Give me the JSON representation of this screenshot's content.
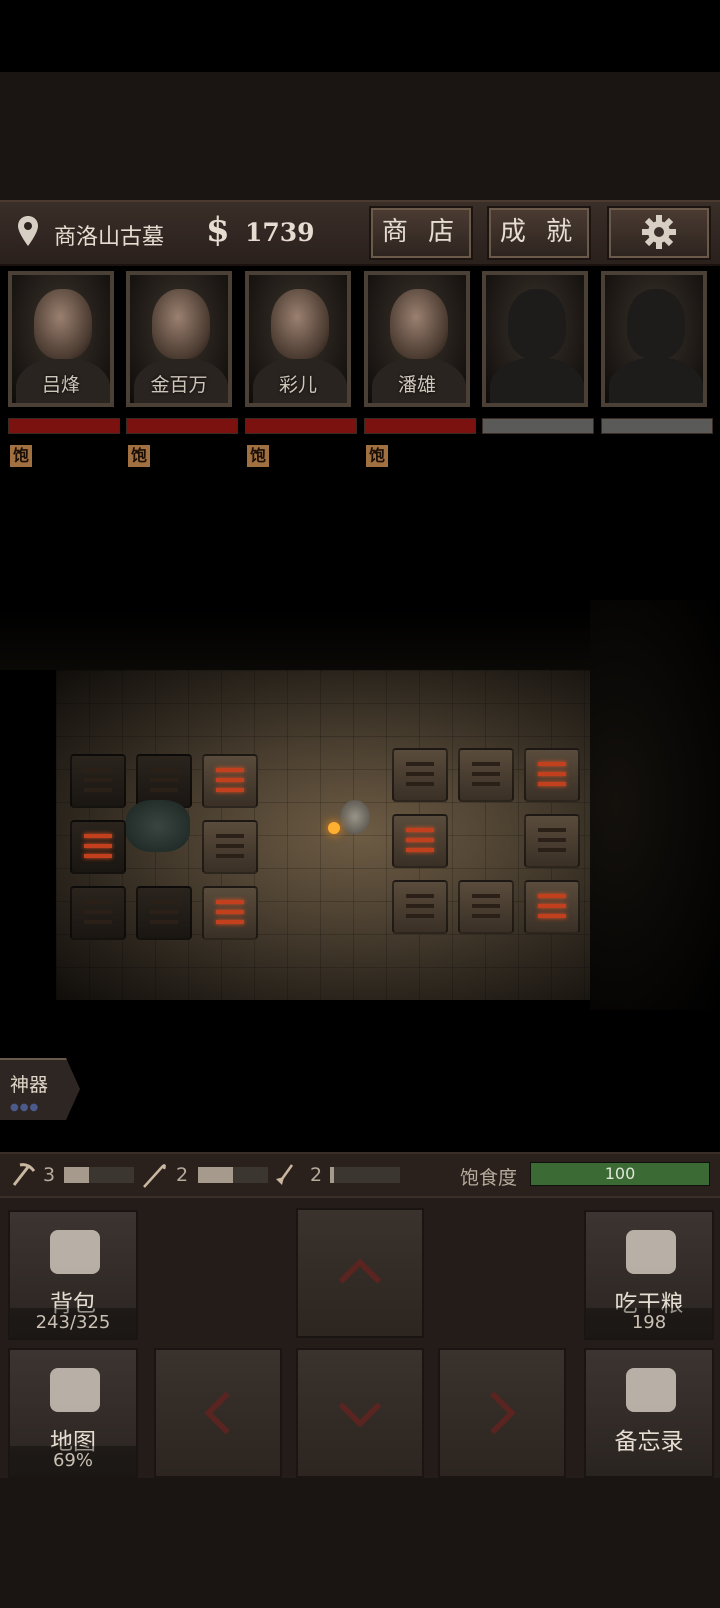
{
  "topbar": {
    "location_icon": "map-pin-icon",
    "location": "商洛山古墓",
    "currency_icon": "dollar-icon",
    "money": "1739",
    "shop_label": "商 店",
    "achievements_label": "成 就",
    "settings_icon": "gear-icon"
  },
  "party": [
    {
      "name": "吕烽",
      "status": "饱"
    },
    {
      "name": "金百万",
      "status": "饱"
    },
    {
      "name": "彩儿",
      "status": "饱"
    },
    {
      "name": "潘雄",
      "status": "饱"
    },
    {
      "name": "",
      "status": ""
    },
    {
      "name": "",
      "status": ""
    }
  ],
  "artifact": {
    "label": "神器"
  },
  "tools": [
    {
      "icon": "pickaxe-icon",
      "count": "3",
      "level": 0.35
    },
    {
      "icon": "hook-icon",
      "count": "2",
      "level": 0.5
    },
    {
      "icon": "shovel-icon",
      "count": "2",
      "level": 0.05
    }
  ],
  "satiety": {
    "label": "饱食度",
    "value": "100",
    "level": 1.0
  },
  "controls": {
    "backpack": {
      "label": "背包",
      "value": "243/325",
      "icon": "backpack-icon"
    },
    "eat": {
      "label": "吃干粮",
      "value": "198",
      "icon": "food-bag-icon"
    },
    "map": {
      "label": "地图",
      "value": "69%",
      "icon": "map-icon"
    },
    "memo": {
      "label": "备忘录",
      "icon": "notebook-icon"
    },
    "up_icon": "arrow-up-icon",
    "down_icon": "arrow-down-icon",
    "left_icon": "arrow-left-icon",
    "right_icon": "arrow-right-icon"
  },
  "colors": {
    "hp": "#7c1210",
    "hp_empty": "#5a5a58",
    "satiety": "#3c6a34",
    "rune_glow": "#c2401e"
  }
}
